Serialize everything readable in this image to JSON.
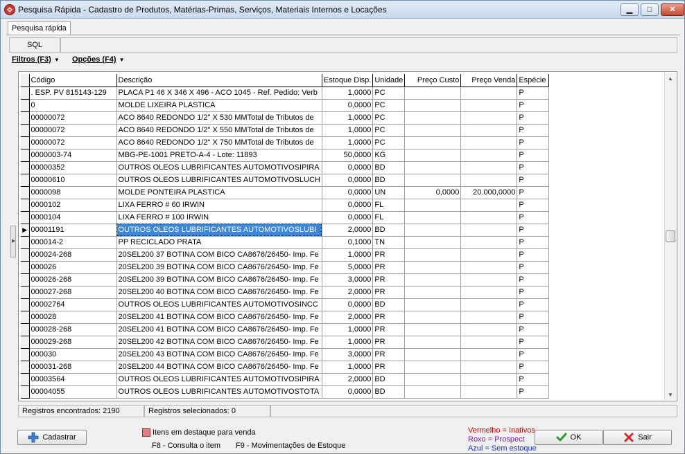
{
  "window": {
    "title": "Pesquisa Rápida - Cadastro de Produtos, Matérias-Primas, Serviços, Materiais Internos e Locações",
    "minimize_glyph": "▁",
    "maximize_glyph": "□",
    "close_glyph": "✕"
  },
  "tabs": [
    {
      "label": "Pesquisa rápida"
    }
  ],
  "sql": {
    "label": "SQL",
    "value": ""
  },
  "menus": {
    "filters": "Filtros (F3)",
    "options": "Opções (F4)",
    "arrow": "▼"
  },
  "grid": {
    "columns": [
      "Código",
      "Descrição",
      "Estoque Disp.",
      "Unidade",
      "Preço Custo",
      "Preço Venda",
      "Espécie"
    ],
    "current_row_marker": "▶",
    "selected_row": 11,
    "rows": [
      {
        "codigo": ". ESP. PV 815143-129",
        "descricao": "PLACA P1 46 X 346 X 496 - ACO 1045 - Ref. Pedido: Verb",
        "estoque": "1,0000",
        "unidade": "PC",
        "custo": "",
        "venda": "",
        "especie": "P"
      },
      {
        "codigo": "0",
        "descricao": "MOLDE LIXEIRA PLASTICA",
        "estoque": "0,0000",
        "unidade": "PC",
        "custo": "",
        "venda": "",
        "especie": "P"
      },
      {
        "codigo": "00000072",
        "descricao": "ACO 8640 REDONDO 1/2\" X 530 MMTotal de Tributos de",
        "estoque": "1,0000",
        "unidade": "PC",
        "custo": "",
        "venda": "",
        "especie": "P"
      },
      {
        "codigo": "00000072",
        "descricao": "ACO 8640 REDONDO 1/2\" X 550 MMTotal de Tributos de",
        "estoque": "1,0000",
        "unidade": "PC",
        "custo": "",
        "venda": "",
        "especie": "P"
      },
      {
        "codigo": "00000072",
        "descricao": "ACO 8640 REDONDO 1/2\" X 750 MMTotal de Tributos de",
        "estoque": "1,0000",
        "unidade": "PC",
        "custo": "",
        "venda": "",
        "especie": "P"
      },
      {
        "codigo": "0000003-74",
        "descricao": "MBG-PE-1001 PRETO-A-4 - Lote: 11893",
        "estoque": "50,0000",
        "unidade": "KG",
        "custo": "",
        "venda": "",
        "especie": "P"
      },
      {
        "codigo": "00000352",
        "descricao": "OUTROS OLEOS LUBRIFICANTES AUTOMOTIVOSIPIRA",
        "estoque": "0,0000",
        "unidade": "BD",
        "custo": "",
        "venda": "",
        "especie": "P"
      },
      {
        "codigo": "00000610",
        "descricao": "OUTROS OLEOS LUBRIFICANTES AUTOMOTIVOSLUCH",
        "estoque": "0,0000",
        "unidade": "BD",
        "custo": "",
        "venda": "",
        "especie": "P"
      },
      {
        "codigo": "0000098",
        "descricao": "MOLDE PONTEIRA PLASTICA",
        "estoque": "0,0000",
        "unidade": "UN",
        "custo": "0,0000",
        "venda": "20.000,0000",
        "especie": "P"
      },
      {
        "codigo": "0000102",
        "descricao": "LIXA FERRO # 60 IRWIN",
        "estoque": "0,0000",
        "unidade": "FL",
        "custo": "",
        "venda": "",
        "especie": "P"
      },
      {
        "codigo": "0000104",
        "descricao": "LIXA FERRO # 100 IRWIN",
        "estoque": "0,0000",
        "unidade": "FL",
        "custo": "",
        "venda": "",
        "especie": "P"
      },
      {
        "codigo": "00001191",
        "descricao": "OUTROS OLEOS LUBRIFICANTES AUTOMOTIVOSLUBI",
        "estoque": "2,0000",
        "unidade": "BD",
        "custo": "",
        "venda": "",
        "especie": "P"
      },
      {
        "codigo": "000014-2",
        "descricao": "PP RECICLADO PRATA",
        "estoque": "0,1000",
        "unidade": "TN",
        "custo": "",
        "venda": "",
        "especie": "P"
      },
      {
        "codigo": "000024-268",
        "descricao": "20SEL200 37 BOTINA COM BICO CA8676/26450- Imp. Fe",
        "estoque": "1,0000",
        "unidade": "PR",
        "custo": "",
        "venda": "",
        "especie": "P"
      },
      {
        "codigo": "000026",
        "descricao": "20SEL200 39 BOTINA COM BICO CA8676/26450- Imp. Fe",
        "estoque": "5,0000",
        "unidade": "PR",
        "custo": "",
        "venda": "",
        "especie": "P"
      },
      {
        "codigo": "000026-268",
        "descricao": "20SEL200 39 BOTINA COM BICO CA8676/26450- Imp. Fe",
        "estoque": "3,0000",
        "unidade": "PR",
        "custo": "",
        "venda": "",
        "especie": "P"
      },
      {
        "codigo": "000027-268",
        "descricao": "20SEL200 40 BOTINA COM BICO CA8676/26450- Imp. Fe",
        "estoque": "2,0000",
        "unidade": "PR",
        "custo": "",
        "venda": "",
        "especie": "P"
      },
      {
        "codigo": "00002764",
        "descricao": "OUTROS OLEOS LUBRIFICANTES AUTOMOTIVOSINCC",
        "estoque": "0,0000",
        "unidade": "BD",
        "custo": "",
        "venda": "",
        "especie": "P"
      },
      {
        "codigo": "000028",
        "descricao": "20SEL200 41 BOTINA COM BICO CA8676/26450- Imp. Fe",
        "estoque": "2,0000",
        "unidade": "PR",
        "custo": "",
        "venda": "",
        "especie": "P"
      },
      {
        "codigo": "000028-268",
        "descricao": "20SEL200 41 BOTINA COM BICO CA8676/26450- Imp. Fe",
        "estoque": "1,0000",
        "unidade": "PR",
        "custo": "",
        "venda": "",
        "especie": "P"
      },
      {
        "codigo": "000029-268",
        "descricao": "20SEL200 42 BOTINA COM BICO CA8676/26450- Imp. Fe",
        "estoque": "1,0000",
        "unidade": "PR",
        "custo": "",
        "venda": "",
        "especie": "P"
      },
      {
        "codigo": "000030",
        "descricao": "20SEL200 43 BOTINA COM BICO CA8676/26450- Imp. Fe",
        "estoque": "3,0000",
        "unidade": "PR",
        "custo": "",
        "venda": "",
        "especie": "P"
      },
      {
        "codigo": "000031-268",
        "descricao": "20SEL200 44 BOTINA COM BICO CA8676/26450- Imp. Fe",
        "estoque": "1,0000",
        "unidade": "PR",
        "custo": "",
        "venda": "",
        "especie": "P"
      },
      {
        "codigo": "00003564",
        "descricao": "OUTROS OLEOS LUBRIFICANTES AUTOMOTIVOSIPIRA",
        "estoque": "2,0000",
        "unidade": "BD",
        "custo": "",
        "venda": "",
        "especie": "P"
      },
      {
        "codigo": "00004055",
        "descricao": "OUTROS OLEOS LUBRIFICANTES AUTOMOTIVOSTOTA",
        "estoque": "0,0000",
        "unidade": "BD",
        "custo": "",
        "venda": "",
        "especie": "P"
      }
    ]
  },
  "scrollbar": {
    "up": "▲",
    "down": "▼",
    "position_fraction": 0.5
  },
  "side_handle": {
    "glyph": "▶"
  },
  "status": {
    "found": "Registros encontrados: 2190",
    "selected": "Registros selecionados: 0"
  },
  "buttons": {
    "cadastrar": "Cadastrar",
    "ok": "OK",
    "sair": "Sair"
  },
  "legend": {
    "highlight": "Itens em destaque para venda",
    "f8": "F8 - Consulta o item",
    "f9": "F9 - Movimentações de Estoque",
    "red": "Vermelho = Inativos",
    "purple": "Roxo = Prospect",
    "blue": "Azul = Sem estoque"
  },
  "colors": {
    "accent_selected": "#3a86d9",
    "inactive": "#cc0000",
    "prospect": "#7a1f9e",
    "no_stock": "#1a2fbf",
    "highlight_swatch": "#e58080"
  },
  "icons": {
    "app": "app-logo-icon",
    "add": "plus-icon",
    "ok": "check-icon",
    "exit": "x-icon"
  }
}
